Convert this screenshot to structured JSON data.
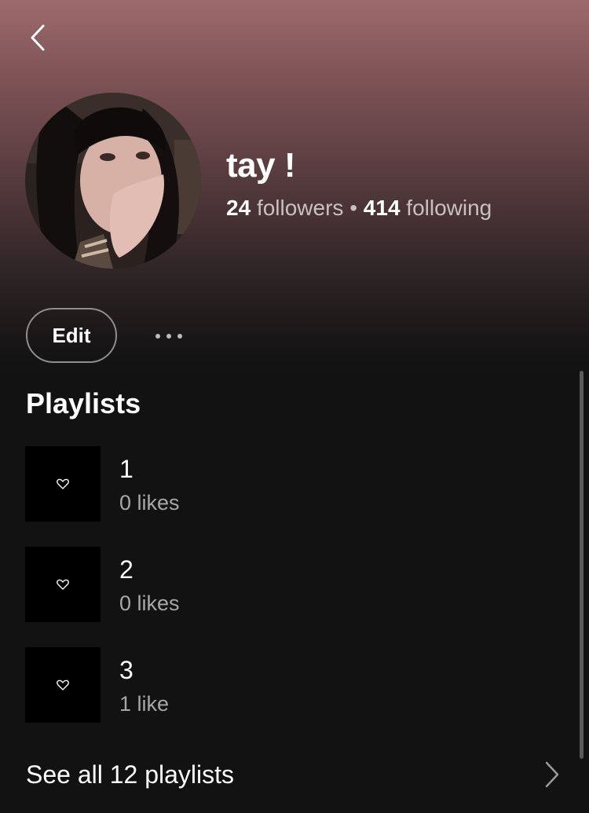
{
  "profile": {
    "name": "tay !",
    "followers_count": "24",
    "followers_label": "followers",
    "separator": "•",
    "following_count": "414",
    "following_label": "following"
  },
  "actions": {
    "edit_label": "Edit",
    "more_icon": "more-horizontal-icon"
  },
  "nav": {
    "back_icon": "chevron-left-icon"
  },
  "playlists_section": {
    "title": "Playlists",
    "items": [
      {
        "title": "1",
        "subtitle": "0 likes",
        "icon": "heart-icon"
      },
      {
        "title": "2",
        "subtitle": "0 likes",
        "icon": "heart-icon"
      },
      {
        "title": "3",
        "subtitle": "1 like",
        "icon": "heart-icon"
      }
    ],
    "see_all_label": "See all 12 playlists",
    "see_all_icon": "chevron-right-icon"
  },
  "colors": {
    "background": "#121212",
    "header_gradient_top": "#9d6a6c",
    "secondary_text": "#a7a7a7"
  }
}
